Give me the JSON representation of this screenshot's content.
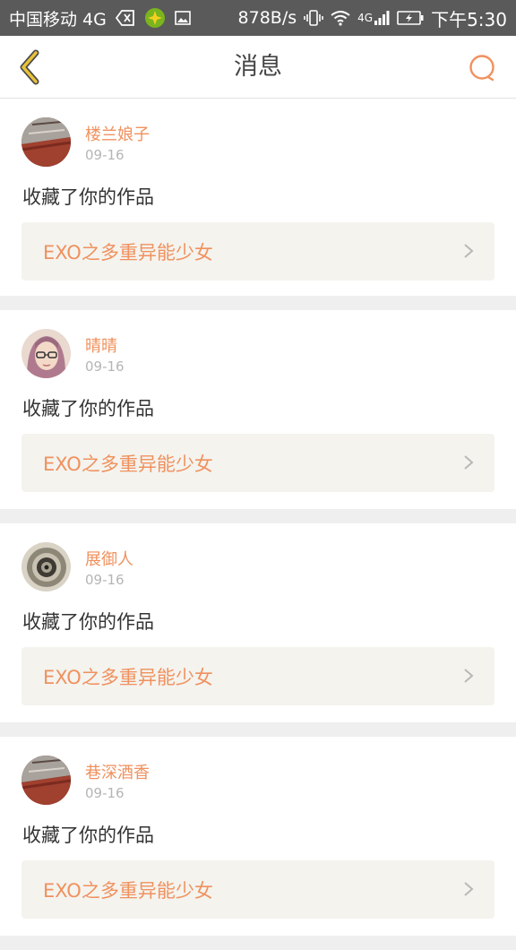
{
  "status_bar": {
    "carrier": "中国移动 4G",
    "speed": "878B/s",
    "network": "4G",
    "time": "下午5:30"
  },
  "header": {
    "title": "消息"
  },
  "colors": {
    "accent": "#f0915e",
    "back_icon": "#e8c23a",
    "card_bg": "#ffffff",
    "link_bg": "#f4f3ee"
  },
  "messages": [
    {
      "username": "楼兰娘子",
      "date": "09-16",
      "action": "收藏了你的作品",
      "work_title": "EXO之多重异能少女"
    },
    {
      "username": "晴晴",
      "date": "09-16",
      "action": "收藏了你的作品",
      "work_title": "EXO之多重异能少女"
    },
    {
      "username": "展御人",
      "date": "09-16",
      "action": "收藏了你的作品",
      "work_title": "EXO之多重异能少女"
    },
    {
      "username": "巷深酒香",
      "date": "09-16",
      "action": "收藏了你的作品",
      "work_title": "EXO之多重异能少女"
    }
  ]
}
